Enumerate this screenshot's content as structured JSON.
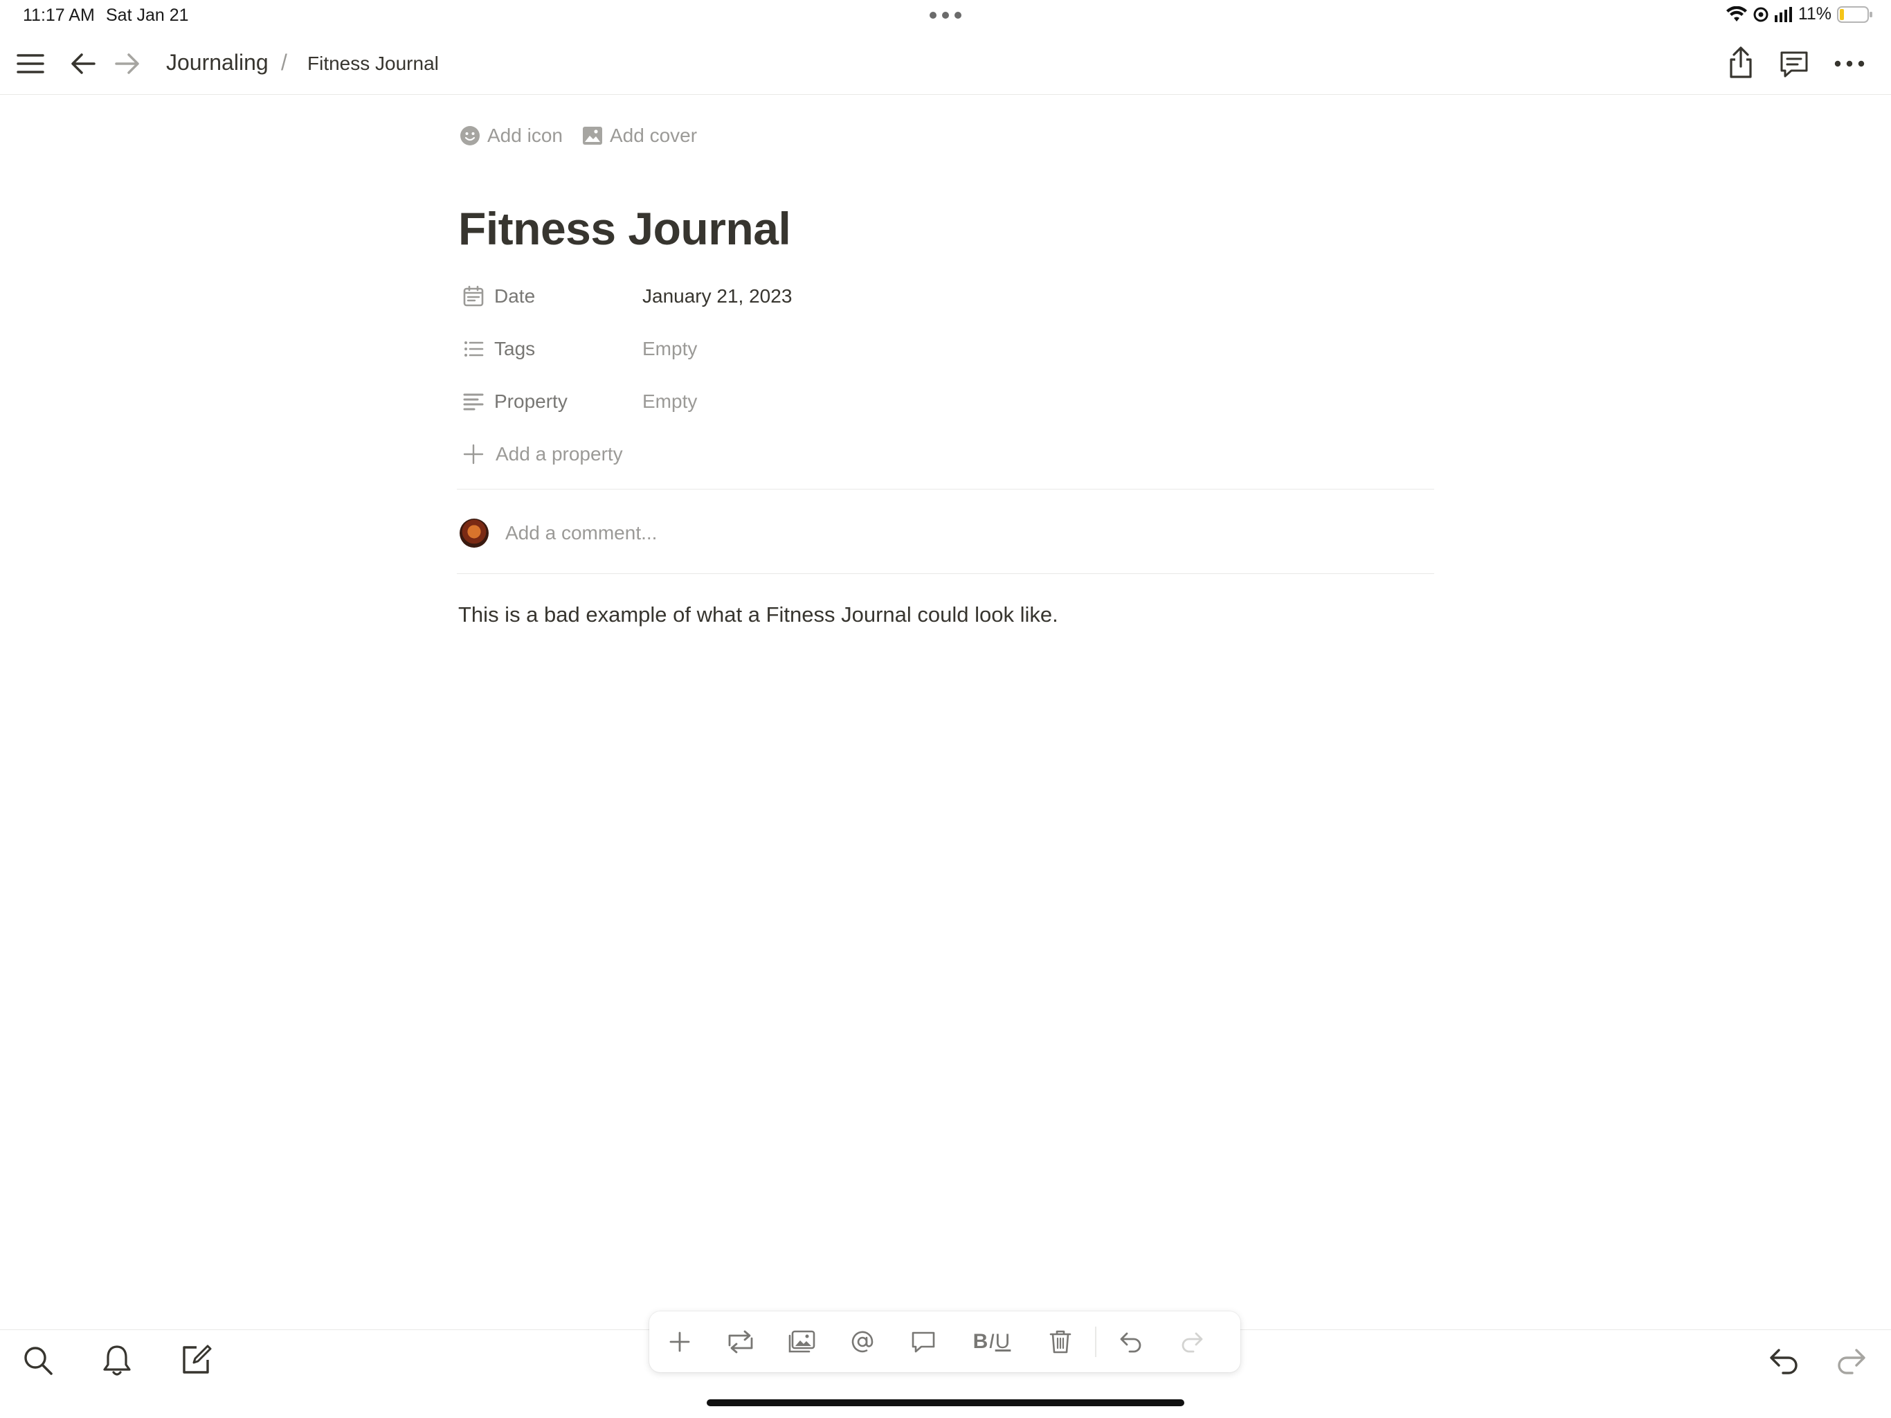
{
  "status_bar": {
    "time": "11:17 AM",
    "date": "Sat Jan 21",
    "battery_percent": "11%"
  },
  "topnav": {
    "breadcrumb": [
      "Journaling",
      "Fitness Journal"
    ],
    "separator": "/"
  },
  "page": {
    "add_icon_label": "Add icon",
    "add_cover_label": "Add cover",
    "title": "Fitness Journal",
    "properties": [
      {
        "icon": "calendar-icon",
        "label": "Date",
        "value": "January 21, 2023",
        "empty": false
      },
      {
        "icon": "list-icon",
        "label": "Tags",
        "value": "Empty",
        "empty": true
      },
      {
        "icon": "text-lines-icon",
        "label": "Property",
        "value": "Empty",
        "empty": true
      }
    ],
    "add_property_label": "Add a property",
    "comment_placeholder": "Add a comment...",
    "body": "This is a bad example of what a Fitness Journal could look like."
  },
  "toolbar": {
    "format_b": "B",
    "format_i": "I",
    "format_u": "U"
  },
  "colors": {
    "text": "#37352f",
    "muted": "#9b9a97",
    "divider": "#e9e9e7",
    "battery_low": "#f5c518"
  }
}
